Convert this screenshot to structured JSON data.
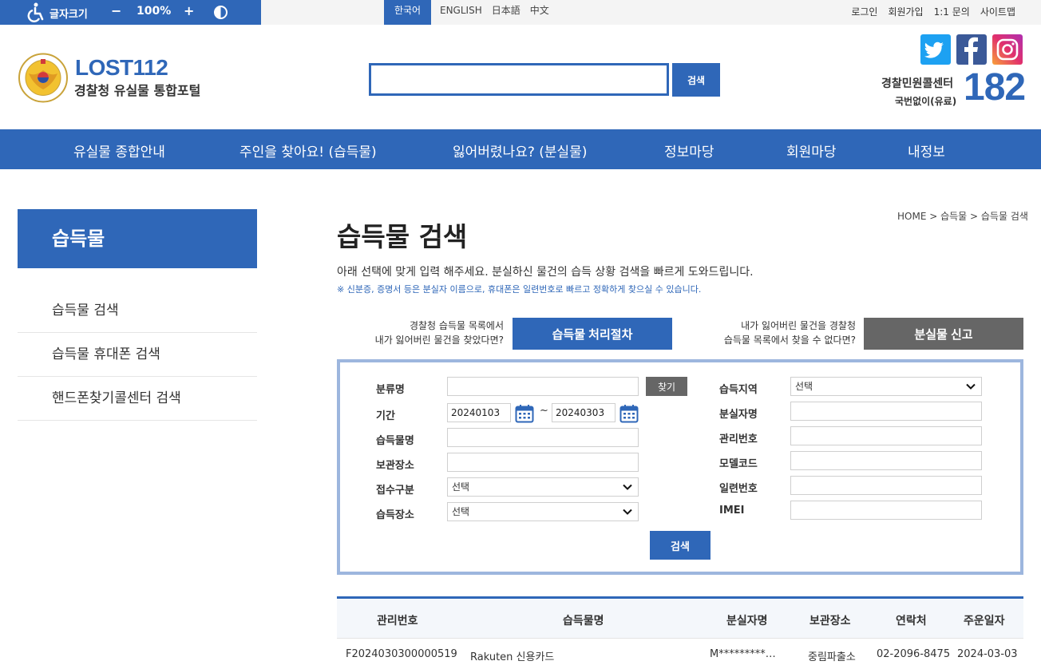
{
  "utility_bar": {
    "font_size_label": "글자크기",
    "decrease": "−",
    "zoom": "100%",
    "increase": "+",
    "languages": [
      "한국어",
      "ENGLISH",
      "日本語",
      "中文"
    ],
    "links": [
      "로그인",
      "회원가입",
      "1:1 문의",
      "사이트맵"
    ]
  },
  "header": {
    "logo_title": "LOST112",
    "logo_subtitle": "경찰청 유실물 통합포털",
    "search_value": "",
    "search_button": "검색",
    "call_center_title": "경찰민원콜센터",
    "call_center_sub": "국번없이(유료)",
    "call_center_number": "182"
  },
  "gnb": [
    "유실물 종합안내",
    "주인을 찾아요! (습득물)",
    "잃어버렸나요? (분실물)",
    "정보마당",
    "회원마당",
    "내정보"
  ],
  "sidebar": {
    "title": "습득물",
    "items": [
      "습득물 검색",
      "습득물 휴대폰 검색",
      "핸드폰찾기콜센터 검색"
    ]
  },
  "content": {
    "breadcrumb": "HOME > 습득물 > 습득물 검색",
    "title": "습득물 검색",
    "description": "아래 선택에 맞게 입력 해주세요. 분실하신 물건의 습득 상황 검색을 빠르게 도와드립니다.",
    "note": "※ 신분증, 증명서 등은 분실자 이름으로, 휴대폰은 일련번호로 빠르고 정확하게 찾으실 수 있습니다.",
    "guide_left_line1": "경찰청 습득물 목록에서",
    "guide_left_line2": "내가 잃어버린 물건을 찾았다면?",
    "guide_left_button": "습득물 처리절차",
    "guide_right_line1": "내가 잃어버린 물건을 경찰청",
    "guide_right_line2": "습득물 목록에서 찾을 수 없다면?",
    "guide_right_button": "분실물 신고"
  },
  "form": {
    "category_label": "분류명",
    "category_value": "",
    "find_button": "찾기",
    "period_label": "기간",
    "start_date": "20240103",
    "period_sep": "~",
    "end_date": "20240303",
    "item_name_label": "습득물명",
    "storage_label": "보관장소",
    "reception_label": "접수구분",
    "reception_value": "선택",
    "found_place_label": "습득장소",
    "found_place_value": "선택",
    "region_label": "습득지역",
    "region_value": "선택",
    "loser_name_label": "분실자명",
    "manage_no_label": "관리번호",
    "model_code_label": "모델코드",
    "serial_label": "일련번호",
    "imei_label": "IMEI",
    "submit": "검색"
  },
  "table": {
    "headers": [
      "관리번호",
      "습득물명",
      "분실자명",
      "보관장소",
      "연락처",
      "주운일자"
    ],
    "rows": [
      [
        "F2024030300000519",
        "Rakuten 신용카드",
        "M*********…",
        "중림파출소",
        "02-2096-8475",
        "2024-03-03"
      ]
    ]
  },
  "colors": {
    "primary": "#2f67b8",
    "panel_border": "#9db6de",
    "dark_button": "#666666"
  }
}
